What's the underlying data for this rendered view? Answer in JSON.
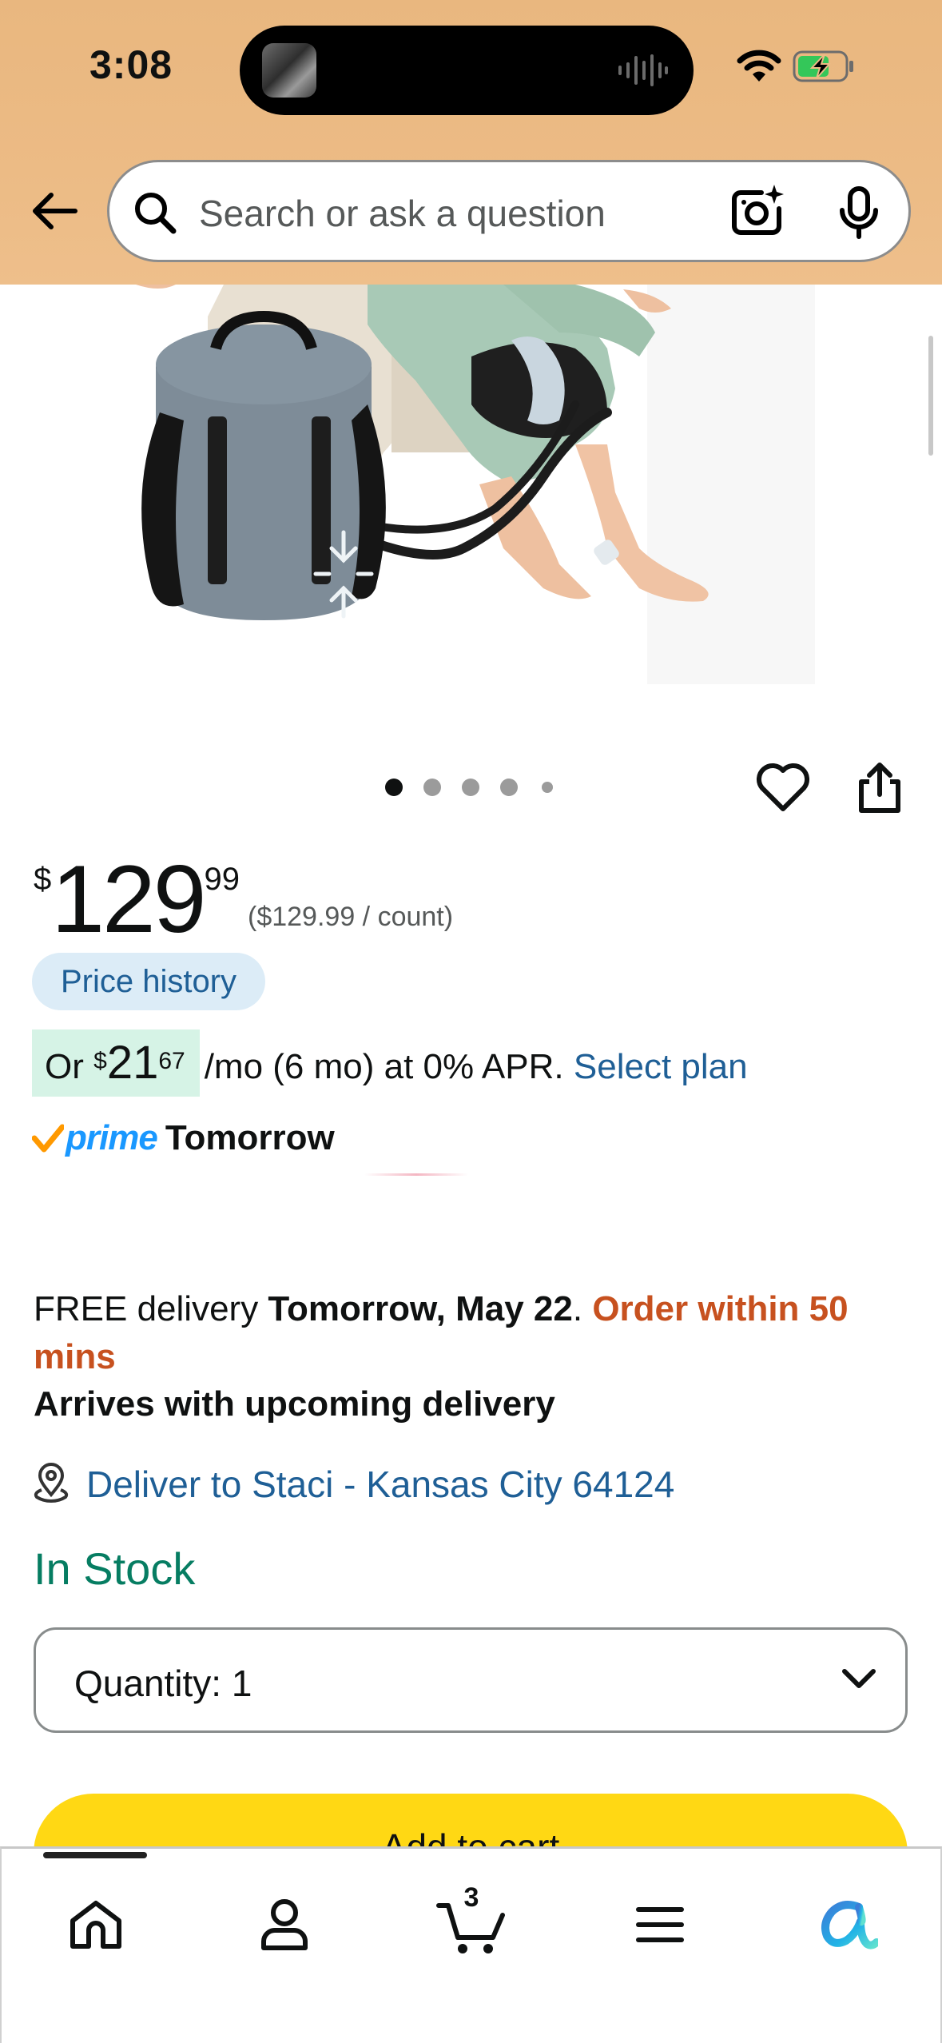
{
  "status_bar": {
    "time": "3:08"
  },
  "search": {
    "placeholder": "Search or ask a question",
    "icons": [
      "back-arrow-icon",
      "search-icon",
      "camera-lens-icon",
      "microphone-icon"
    ]
  },
  "carousel": {
    "image_count": 5,
    "active_index": 0,
    "icons": [
      "heart-icon",
      "share-icon"
    ]
  },
  "price": {
    "currency": "$",
    "whole": "129",
    "fraction": "99",
    "unit_price": "($129.99 / count)",
    "history_label": "Price history"
  },
  "installment": {
    "prefix": "Or",
    "currency": "$",
    "whole": "21",
    "fraction": "67",
    "terms": "/mo (6 mo) at 0% APR.",
    "select_plan": "Select plan"
  },
  "prime": {
    "logo_text": "prime",
    "day": "Tomorrow"
  },
  "delivery": {
    "prefix": "FREE delivery",
    "date": "Tomorrow, May 22",
    "period": ".",
    "urgency": "Order within 50 mins",
    "arrives": "Arrives with upcoming delivery",
    "deliver_to": "Deliver to Staci - Kansas City 64124"
  },
  "stock": {
    "status": "In Stock"
  },
  "quantity": {
    "label": "Quantity:",
    "value": "1"
  },
  "add_to_cart": {
    "label": "Add to cart"
  },
  "bottom_nav": {
    "items": [
      "home",
      "account",
      "cart",
      "menu",
      "rufus"
    ],
    "cart_count": "3",
    "active": "home"
  },
  "colors": {
    "header_bg": "#ecbb85",
    "link": "#1f5f96",
    "in_stock": "#067d62",
    "urgency": "#c7511f",
    "add_to_cart": "#ffd814",
    "price_history_bg": "#dcecf7",
    "installment_bg": "#d6f3e6",
    "prime_blue": "#1a98ff"
  }
}
